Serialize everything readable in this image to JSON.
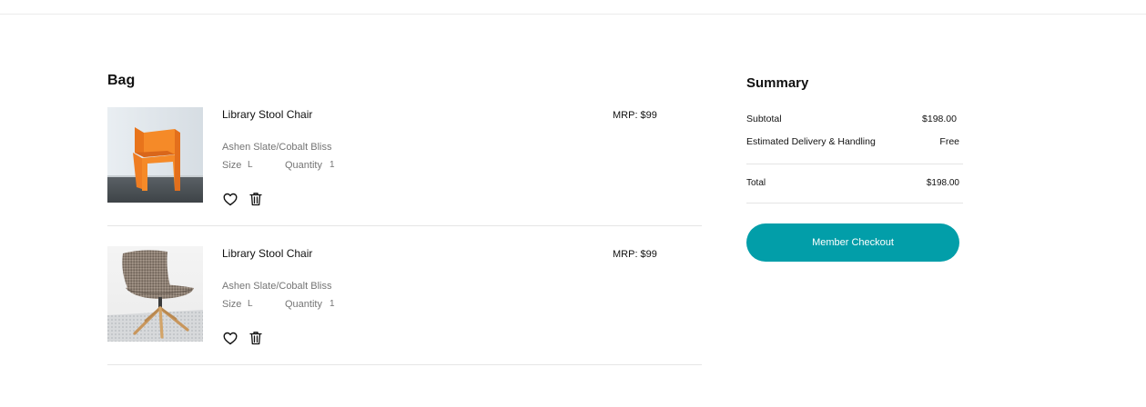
{
  "colors": {
    "accent": "#029ea9",
    "divider": "#e5e5e5",
    "muted_text": "#757575"
  },
  "bag": {
    "title": "Bag",
    "items": [
      {
        "image": "orange-chair-photo",
        "name": "Library Stool Chair",
        "color": "Ashen Slate/Cobalt Bliss",
        "size_label": "Size",
        "size": "L",
        "quantity_label": "Quantity",
        "quantity": "1",
        "price": "MRP: $99",
        "favorite_icon": "heart-icon",
        "delete_icon": "trash-icon"
      },
      {
        "image": "swivel-lounge-chair-photo",
        "name": "Library Stool Chair",
        "color": "Ashen Slate/Cobalt Bliss",
        "size_label": "Size",
        "size": "L",
        "quantity_label": "Quantity",
        "quantity": "1",
        "price": "MRP: $99",
        "favorite_icon": "heart-icon",
        "delete_icon": "trash-icon"
      }
    ]
  },
  "summary": {
    "title": "Summary",
    "subtotal_label": "Subtotal",
    "subtotal_value": "$198.00",
    "delivery_label": "Estimated Delivery & Handling",
    "delivery_value": "Free",
    "total_label": "Total",
    "total_value": "$198.00",
    "checkout_label": "Member Checkout"
  }
}
